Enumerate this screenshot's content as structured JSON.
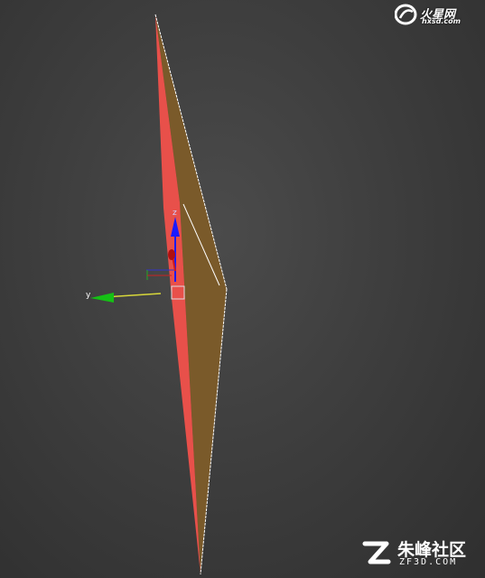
{
  "viewport": {
    "gizmo": {
      "z_label": "z",
      "y_label": "y",
      "z_color": "#1a1aff",
      "y_color": "#15c015",
      "x_color": "#d01818"
    },
    "object": {
      "front_face_color": "#e8504a",
      "side_face_color": "#7a5a2a",
      "edge_color": "#ffffff"
    }
  },
  "watermark_top": {
    "name": "火星网",
    "url": "hxsd.com"
  },
  "watermark_bottom": {
    "name": "朱峰社区",
    "url": "ZF3D.COM"
  }
}
